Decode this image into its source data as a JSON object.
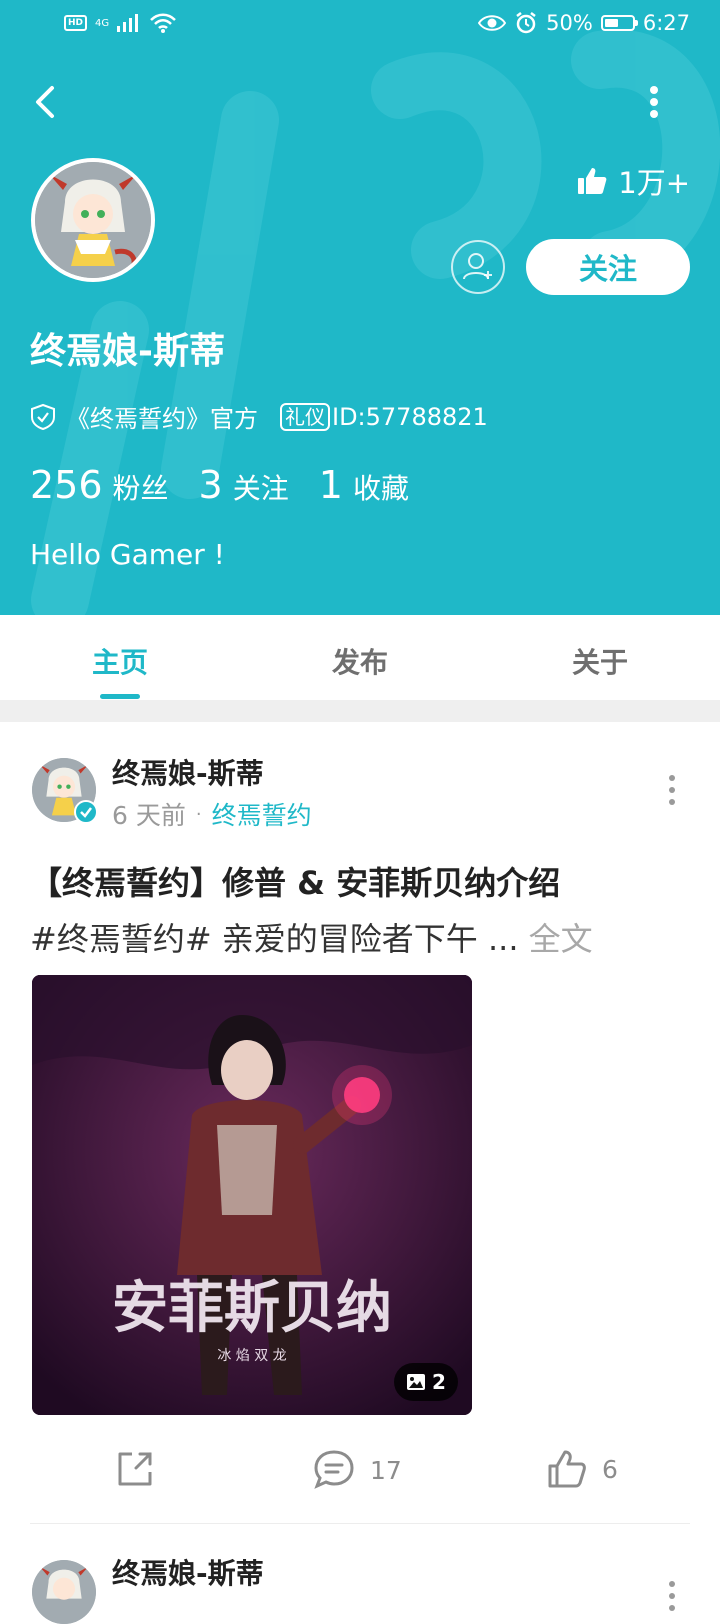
{
  "status_bar": {
    "network_hd": "HD",
    "network_type": "4G",
    "battery_percent": "50%",
    "battery_level": 0.5,
    "time": "6:27"
  },
  "profile": {
    "name": "终焉娘-斯蒂",
    "likes_total": "1万+",
    "follow_label": "关注",
    "official_text": "《终焉誓约》官方",
    "etiquette_badge": "礼仪",
    "user_id": "ID:57788821",
    "followers_count": "256",
    "followers_label": "粉丝",
    "following_count": "3",
    "following_label": "关注",
    "favorites_count": "1",
    "favorites_label": "收藏",
    "bio": "Hello Gamer !"
  },
  "tabs": [
    {
      "label": "主页",
      "active": true
    },
    {
      "label": "发布",
      "active": false
    },
    {
      "label": "关于",
      "active": false
    }
  ],
  "posts": [
    {
      "author": "终焉娘-斯蒂",
      "time_ago": "6 天前",
      "separator": "·",
      "channel": "终焉誓约",
      "title": "【终焉誓约】修普 & 安菲斯贝纳介绍",
      "excerpt": "#终焉誓约# 亲爱的冒险者下午 ...",
      "read_more": "全文",
      "image_count": "2",
      "image_overlay_title": "安菲斯贝纳",
      "image_overlay_subtitle": "冰 焰 双 龙",
      "comments": "17",
      "likes": "6"
    },
    {
      "author": "终焉娘-斯蒂"
    }
  ],
  "colors": {
    "brand": "#1fb8c8",
    "header_bg": "#1fb8c8",
    "text_primary": "#222222",
    "text_secondary": "#9a9a9a"
  },
  "icons": {
    "back": "chevron-left-icon",
    "more": "more-vertical-icon",
    "like": "thumbs-up-icon",
    "add_friend": "add-user-icon",
    "verified": "shield-check-icon",
    "share": "share-icon",
    "comment": "comment-icon",
    "image": "image-icon"
  }
}
